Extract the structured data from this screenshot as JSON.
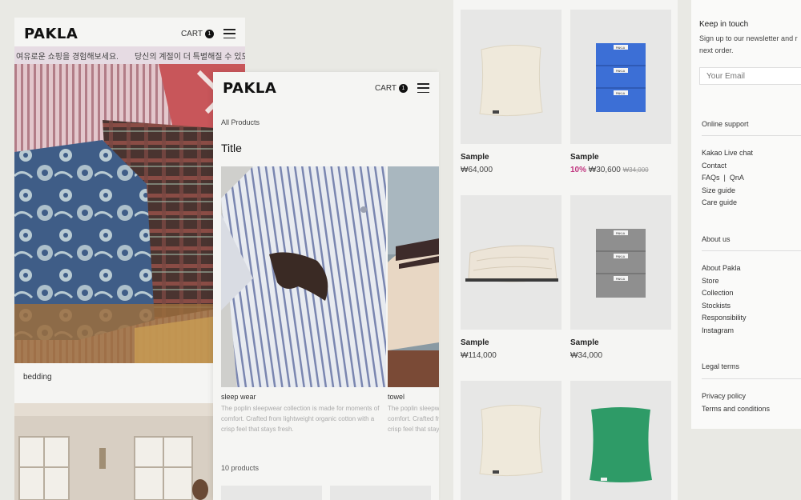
{
  "left_panel": {
    "brand": "PAKLA",
    "cart_label": "CART",
    "cart_count": "1",
    "marquee_left": "여유로운 쇼핑을 경험해보세요.",
    "marquee_right": "당신의 계절이 더 특별해질 수 있도록",
    "hero_caption": "bedding"
  },
  "middle_panel": {
    "brand": "PAKLA",
    "cart_label": "CART",
    "cart_count": "1",
    "breadcrumb": "All Products",
    "title": "Title",
    "cards": [
      {
        "label": "sleep wear",
        "desc": "The poplin sleepwear collection is made for moments of comfort. Crafted from lightweight organic cotton with a crisp feel that stays fresh."
      },
      {
        "label": "towel",
        "desc": "The poplin sleepwear collection is made for moments of comfort. Crafted from lightweight organic cotton with a crisp feel that stays fresh."
      }
    ],
    "product_count": "10 products"
  },
  "grid_panel": {
    "products": [
      {
        "name": "Sample",
        "price": "₩64,000"
      },
      {
        "name": "Sample",
        "discount": "10%",
        "price": "₩30,600",
        "original": "₩34,000"
      },
      {
        "name": "Sample",
        "price": "₩114,000"
      },
      {
        "name": "Sample",
        "price": "₩34,000"
      }
    ],
    "tag_text": "PAKLA"
  },
  "footer_panel": {
    "newsletter_title": "Keep in touch",
    "newsletter_desc": "Sign up to our newsletter and r... next order.",
    "newsletter_desc_line1": "Sign up to our newsletter and r",
    "newsletter_desc_line2": "next order.",
    "email_placeholder": "Your Email",
    "sections": [
      {
        "heading": "Online support",
        "links": [
          "Kakao Live chat",
          "Contact",
          "FAQs  |  QnA",
          "Size guide",
          "Care guide"
        ]
      },
      {
        "heading": "About us",
        "links": [
          "About Pakla",
          "Store",
          "Collection",
          "Stockists",
          "Responsibility",
          "Instagram"
        ]
      },
      {
        "heading": "Legal terms",
        "links": [
          "Privacy policy",
          "Terms and conditions"
        ]
      }
    ]
  },
  "colors": {
    "background": "#e9e9e4",
    "panel": "#f5f5f3",
    "marquee": "#e6dbe3",
    "sale": "#c0357f",
    "blue_towel": "#3c6fd6",
    "grey_towel": "#8f8f8f",
    "green_pillow": "#2e9b67"
  }
}
